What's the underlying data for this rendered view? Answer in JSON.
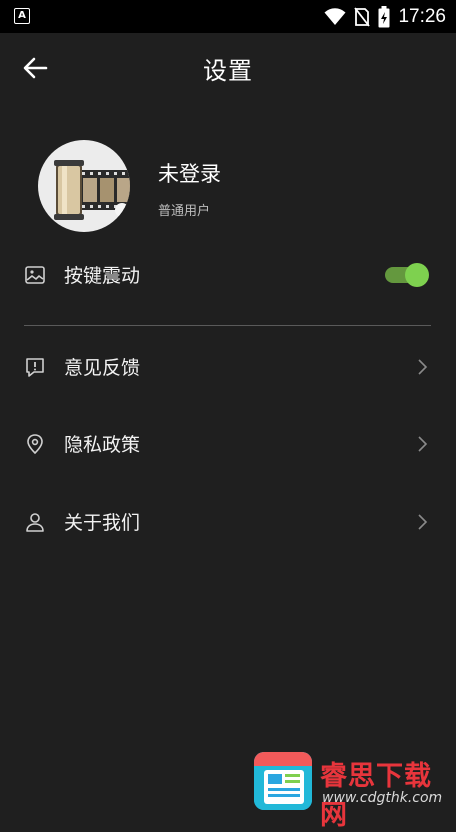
{
  "status_bar": {
    "notification_icon": "a-letter-icon",
    "time": "17:26",
    "icons": [
      "wifi-icon",
      "no-sim-icon",
      "battery-charging-icon"
    ]
  },
  "header": {
    "title": "设置",
    "back_icon": "back-arrow-icon"
  },
  "profile": {
    "username": "未登录",
    "user_type": "普通用户",
    "avatar_icon": "film-roll-icon"
  },
  "settings": {
    "vibration": {
      "label": "按键震动",
      "icon": "image-icon",
      "enabled": true
    },
    "feedback": {
      "label": "意见反馈",
      "icon": "feedback-icon"
    },
    "privacy": {
      "label": "隐私政策",
      "icon": "location-shield-icon"
    },
    "about": {
      "label": "关于我们",
      "icon": "person-icon"
    }
  },
  "colors": {
    "background": "#1f1f1f",
    "accent": "#7ed14f",
    "divider": "#5a5a5a"
  },
  "watermark": {
    "name": "睿思下载网",
    "url": "www.cdgthk.com"
  }
}
